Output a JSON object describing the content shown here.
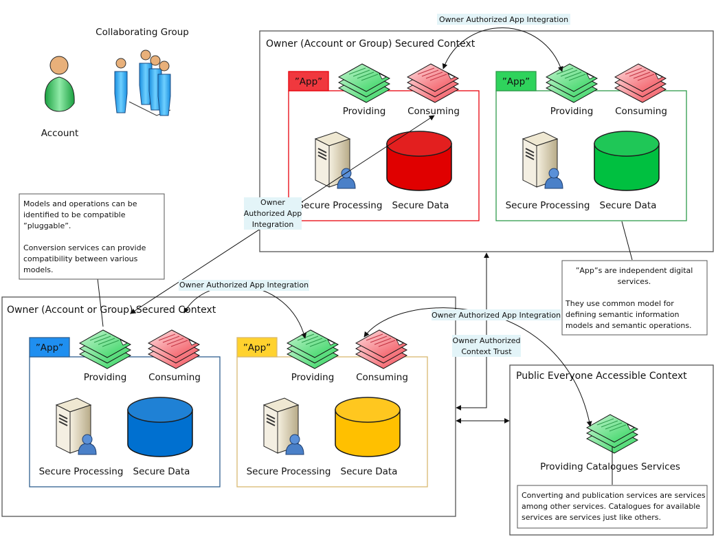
{
  "actors": {
    "account": "Account",
    "group": "Collaborating Group"
  },
  "contexts": {
    "top": {
      "title": "Owner (Account or Group) Secured Context"
    },
    "bottom": {
      "title": "Owner (Account or Group) Secured Context"
    },
    "public": {
      "title": "Public Everyone Accessible Context",
      "service_label": "Providing Catalogues Services"
    }
  },
  "apps": [
    {
      "tab": "”App”",
      "color": "#e8000a",
      "tab_fill": "#f0383e",
      "data_color": "#e00000",
      "providing": "Providing",
      "consuming": "Consuming",
      "processing": "Secure Processing",
      "data": "Secure Data"
    },
    {
      "tab": "”App”",
      "color": "#2e9a4a",
      "tab_fill": "#2fd35c",
      "data_color": "#00c040",
      "providing": "Providing",
      "consuming": "Consuming",
      "processing": "Secure Processing",
      "data": "Secure Data"
    },
    {
      "tab": "”App”",
      "color": "#2f5f8f",
      "tab_fill": "#1f8ff0",
      "data_color": "#0070d0",
      "providing": "Providing",
      "consuming": "Consuming",
      "processing": "Secure Processing",
      "data": "Secure Data"
    },
    {
      "tab": "”App”",
      "color": "#d8b870",
      "tab_fill": "#ffd22e",
      "data_color": "#ffc000",
      "providing": "Providing",
      "consuming": "Consuming",
      "processing": "Secure Processing",
      "data": "Secure Data"
    }
  ],
  "labels": {
    "integration_top": "Owner Authorized App Integration",
    "integration_diag": [
      "Owner",
      "Authorized App",
      "Integration"
    ],
    "integration_bottom": "Owner Authorized App Integration",
    "integration_cross": "Owner Authorized App Integration",
    "context_trust": [
      "Owner Authorized",
      "Context Trust"
    ]
  },
  "notes": {
    "models": [
      "Models and operations can be",
      "identified to be compatible",
      "”pluggable”.",
      "",
      "Conversion services can provide",
      "compatibility between various",
      "models."
    ],
    "apps": [
      "”App”s are independent digital",
      "services.",
      "",
      "They use common model for",
      "defining semantic information",
      "models and semantic operations."
    ],
    "catalogue": [
      "Converting and publication services are services",
      "among other services. Catalogues for available",
      "services are services just like others."
    ]
  },
  "colors": {
    "label_bg": "#e3f4f8",
    "provide": "#3ad46a",
    "consume": "#f0606a",
    "frame": "#555555"
  }
}
